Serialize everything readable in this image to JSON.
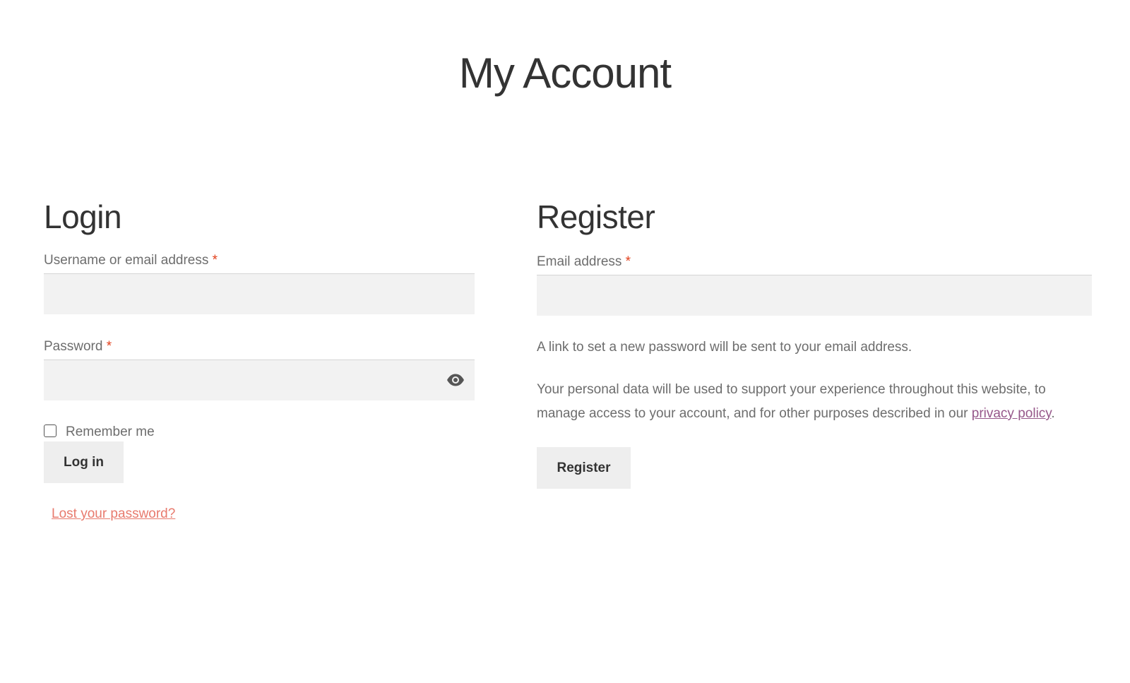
{
  "page": {
    "title": "My Account"
  },
  "login": {
    "heading": "Login",
    "username_label": "Username or email address",
    "required_mark": "*",
    "username_value": "",
    "password_label": "Password",
    "password_value": "",
    "remember_label": "Remember me",
    "remember_checked": false,
    "submit_label": "Log in",
    "lost_password_label": "Lost your password?"
  },
  "register": {
    "heading": "Register",
    "email_label": "Email address",
    "required_mark": "*",
    "email_value": "",
    "password_note": "A link to set a new password will be sent to your email address.",
    "privacy_text_before": "Your personal data will be used to support your experience throughout this website, to manage access to your account, and for other purposes described in our ",
    "privacy_link_label": "privacy policy",
    "privacy_text_after": ".",
    "submit_label": "Register"
  },
  "icons": {
    "password_toggle": "eye-icon"
  },
  "colors": {
    "required": "#e2401c",
    "lost_link": "#e87a6d",
    "privacy_link": "#96588a",
    "input_bg": "#f2f2f2",
    "button_bg": "#eeeeee"
  }
}
